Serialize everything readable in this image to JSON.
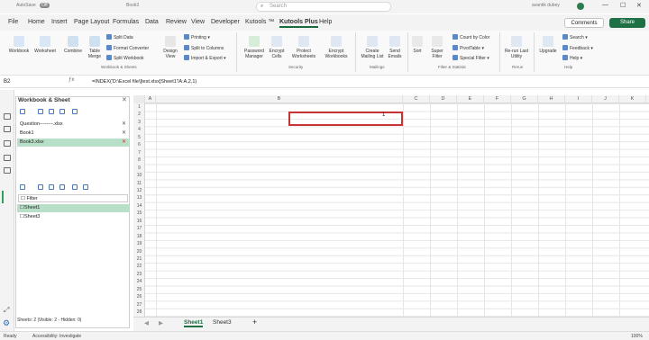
{
  "titlebar": {
    "autosave": "AutoSave",
    "autosave_state": "Off",
    "filename": "Book3",
    "search_placeholder": "Search",
    "user": "avantik dubey"
  },
  "menu": [
    "File",
    "Home",
    "Insert",
    "Page Layout",
    "Formulas",
    "Data",
    "Review",
    "View",
    "Developer",
    "Kutools ™",
    "Kutools Plus",
    "Help"
  ],
  "menu_active": "Kutools Plus",
  "comments_label": "Comments",
  "share_label": "Share",
  "ribbon": {
    "workbook": "Workbook",
    "worksheet": "Worksheet",
    "combine": "Combine",
    "table_merge": "Table Merge",
    "split_data": "Split Data",
    "format_converter": "Format Converter",
    "split_workbook": "Split Workbook",
    "design_view": "Design View",
    "printing": "Printing",
    "split_to_columns": "Split to Columns",
    "import_export": "Import & Export",
    "group_workbook": "Workbook & Sheets",
    "password_manager": "Password Manager",
    "encrypt_cells": "Encrypt Cells",
    "protect_worksheets": "Protect Worksheets",
    "encrypt_workbooks": "Encrypt Workbooks",
    "group_security": "Security",
    "create_mailing_list": "Create Mailing List",
    "send_emails": "Send Emails",
    "group_mailings": "Mailings",
    "sort": "Sort",
    "super_filter": "Super Filter",
    "count_by_color": "Count by Color",
    "pivot_table": "PivotTable",
    "special_filter": "Special Filter",
    "group_filter": "Filter & Statistic",
    "rerun": "Re-run Last Utility",
    "group_rerun": "Rerun",
    "upgrade": "Upgrade",
    "search": "Search",
    "feedback": "Feedback",
    "help": "Help",
    "group_help": "Help"
  },
  "formula_bar": {
    "name_box": "B2",
    "formula": "=INDEX('D:\\Excel file\\[test.xlsx]Sheet1'!A:A,2,1)"
  },
  "pane": {
    "title": "Workbook & Sheet",
    "workbooks": [
      "Question--------.xlsx",
      "Book1",
      "Book3.xlsx"
    ],
    "active_workbook": "Book3.xlsx",
    "filter_label": "Filter",
    "sheets": [
      "Sheet1",
      "Sheet3"
    ],
    "active_sheet": "Sheet1",
    "status": "Sheets: 2  |Visible: 2  -  Hidden: 0|"
  },
  "grid": {
    "columns": [
      "A",
      "B",
      "C",
      "D",
      "E",
      "F",
      "G",
      "H",
      "I",
      "J",
      "K"
    ],
    "rows": [
      "1",
      "2",
      "3",
      "4",
      "5",
      "6",
      "7",
      "8",
      "9",
      "10",
      "11",
      "12",
      "13",
      "14",
      "15",
      "16",
      "17",
      "18",
      "19",
      "20",
      "21",
      "22",
      "23",
      "24",
      "25",
      "26",
      "27",
      "28"
    ],
    "b2_value": "1"
  },
  "tabs": [
    "Sheet1",
    "Sheet3"
  ],
  "add_sheet": "+",
  "statusbar": {
    "ready": "Ready",
    "accessibility": "Accessibility: Investigate",
    "zoom": "100%"
  }
}
